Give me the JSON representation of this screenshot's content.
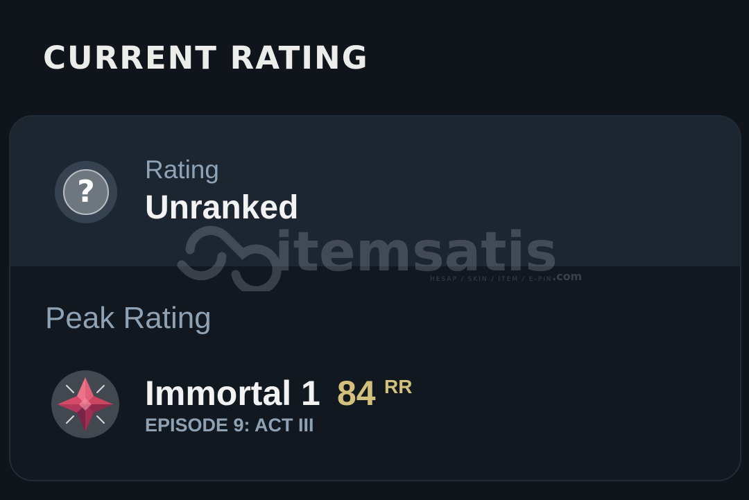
{
  "header": {
    "title": "CURRENT RATING"
  },
  "current": {
    "label": "Rating",
    "value": "Unranked",
    "icon": "question-mark-icon",
    "icon_glyph": "?"
  },
  "peak": {
    "label": "Peak Rating",
    "rank": "Immortal 1",
    "rr_value": "84",
    "rr_unit": "RR",
    "episode": "EPISODE 9: ACT III",
    "icon": "immortal-rank-icon"
  },
  "watermark": {
    "brand": "itemsatis",
    "tagline": "HESAP / SKIN / ITEM / E-PIN",
    "suffix": ".com"
  },
  "colors": {
    "background": "#10151c",
    "card_top": "#1c2631",
    "card_bottom": "#111820",
    "label": "#8ea2b4",
    "rr_gold": "#d3c07c",
    "immortal_red": "#c73a5f"
  }
}
